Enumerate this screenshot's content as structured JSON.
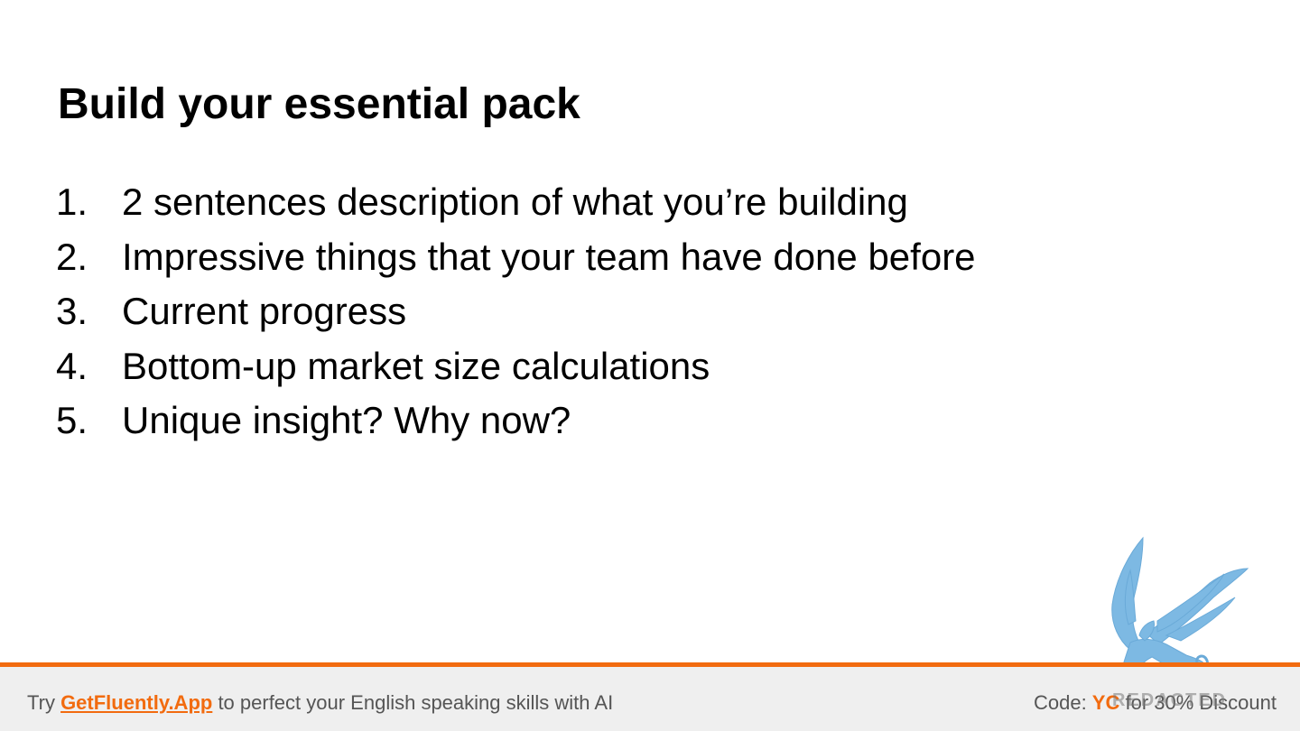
{
  "slide": {
    "title": "Build your essential pack",
    "items": [
      {
        "num": "1.",
        "text": "2 sentences description of what you’re building"
      },
      {
        "num": "2.",
        "text": "Impressive things that your team have done before"
      },
      {
        "num": "3.",
        "text": "Current progress"
      },
      {
        "num": "4.",
        "text": "Bottom-up market size calculations"
      },
      {
        "num": "5.",
        "text": "Unique insight? Why now?"
      }
    ]
  },
  "footer": {
    "left_prefix": "Try ",
    "link_text": "GetFluently.App",
    "left_suffix": " to perfect your English speaking skills with AI",
    "code_prefix": "Code: ",
    "code": "YC",
    "code_suffix": " for 30% Discount"
  },
  "watermark": {
    "icon": "griffin-logo-icon",
    "text": "REDACTED"
  },
  "colors": {
    "accent": "#f26b0f",
    "footer_bg": "#efefef",
    "footer_text": "#555555",
    "logo_blue": "#7db9e3"
  }
}
